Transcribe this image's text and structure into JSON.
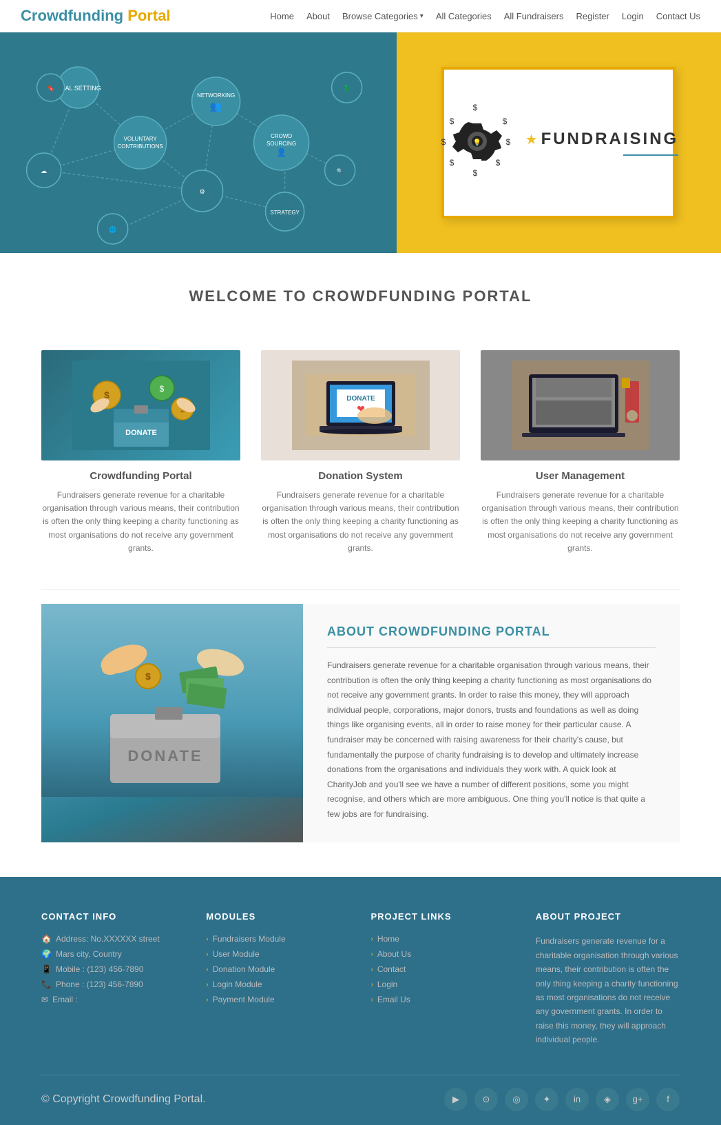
{
  "nav": {
    "logo_part1": "Crowdfunding ",
    "logo_part2": "Portal",
    "links": [
      "Home",
      "About",
      "Browse Categories",
      "All Categories",
      "All Fundraisers",
      "Register",
      "Login",
      "Contact Us"
    ]
  },
  "hero": {
    "card_text": "Fundraising"
  },
  "welcome": {
    "heading": "WELCOME TO CROWDFUNDING PORTAL",
    "features": [
      {
        "title": "Crowdfunding Portal",
        "description": "Fundraisers generate revenue for a charitable organisation through various means, their contribution is often the only thing keeping a charity functioning as most organisations do not receive any government grants.",
        "color": "#2e7a8c",
        "icon": "💰"
      },
      {
        "title": "Donation System",
        "description": "Fundraisers generate revenue for a charitable organisation through various means, their contribution is often the only thing keeping a charity functioning as most organisations do not receive any government grants.",
        "color": "#5a8a7a",
        "icon": "💻"
      },
      {
        "title": "User Management",
        "description": "Fundraisers generate revenue for a charitable organisation through various means, their contribution is often the only thing keeping a charity functioning as most organisations do not receive any government grants.",
        "color": "#8a7a5a",
        "icon": "📊"
      }
    ]
  },
  "about": {
    "heading": "ABOUT CROWDFUNDING PORTAL",
    "text": "Fundraisers generate revenue for a charitable organisation through various means, their contribution is often the only thing keeping a charity functioning as most organisations do not receive any government grants. In order to raise this money, they will approach individual people, corporations, major donors, trusts and foundations as well as doing things like organising events, all in order to raise money for their particular cause. A fundraiser may be concerned with raising awareness for their charity's cause, but fundamentally the purpose of charity fundraising is to develop and ultimately increase donations from the organisations and individuals they work with. A quick look at CharityJob and you'll see we have a number of different positions, some you might recognise, and others which are more ambiguous. One thing you'll notice is that quite a few jobs are for fundraising."
  },
  "footer": {
    "contact_info": {
      "heading": "CONTACT INFO",
      "items": [
        {
          "icon": "🏠",
          "text": "Address: No.XXXXXX street"
        },
        {
          "icon": "🌍",
          "text": "Mars city, Country"
        },
        {
          "icon": "📱",
          "text": "Mobile : (123) 456-7890"
        },
        {
          "icon": "📞",
          "text": "Phone : (123) 456-7890"
        },
        {
          "icon": "✉",
          "text": "Email :"
        }
      ]
    },
    "modules": {
      "heading": "MODULES",
      "items": [
        "Fundraisers Module",
        "User Module",
        "Donation Module",
        "Login Module",
        "Payment Module"
      ]
    },
    "project_links": {
      "heading": "PROJECT LINKS",
      "items": [
        "Home",
        "About Us",
        "Contact",
        "Login",
        "Email Us"
      ]
    },
    "about_project": {
      "heading": "ABOUT PROJECT",
      "text": "Fundraisers generate revenue for a charitable organisation through various means, their contribution is often the only thing keeping a charity functioning as most organisations do not receive any government grants. In order to raise this money, they will approach individual people."
    },
    "copyright": "© Copyright Crowdfunding Portal.",
    "social_icons": [
      "▶",
      "⊙",
      "◎",
      "✦",
      "in",
      "◈",
      "g+",
      "f"
    ]
  }
}
